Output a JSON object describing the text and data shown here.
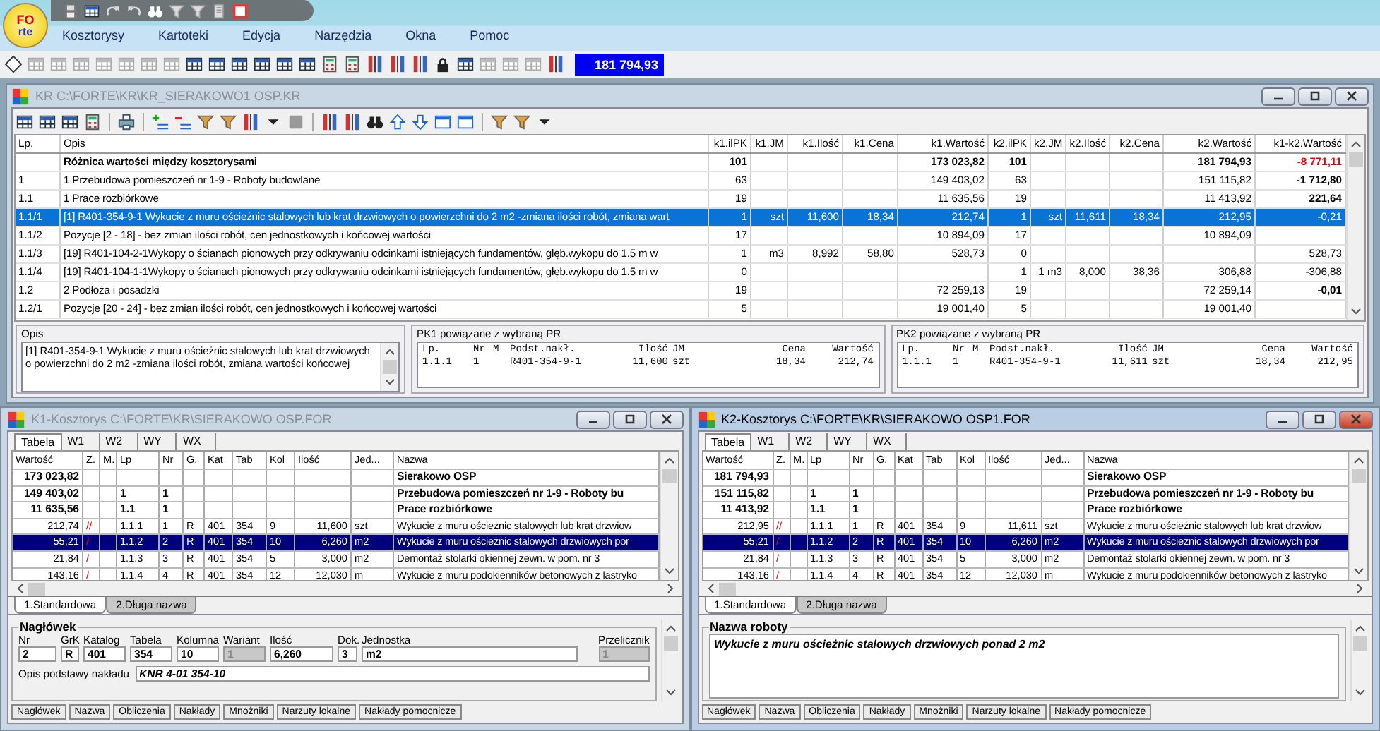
{
  "app": {
    "logo": [
      "FO",
      "rte"
    ],
    "menu": [
      "Kosztorysy",
      "Kartoteki",
      "Edycja",
      "Narzędzia",
      "Okna",
      "Pomoc"
    ],
    "counter": "181 794,93"
  },
  "kr_window": {
    "title": "KR C:\\FORTE\\KR\\KR_SIERAKOWO1 OSP.KR",
    "active": false,
    "columns": [
      "Lp.",
      "Opis",
      "k1.ilPK",
      "k1.JM",
      "k1.Ilość",
      "k1.Cena",
      "k1.Wartość",
      "k2.ilPK",
      "k2.JM",
      "k2.Ilość",
      "k2.Cena",
      "k2.Wartość",
      "k1-k2.Wartość"
    ],
    "rows": [
      {
        "opis": "Różnica wartości między kosztorysami",
        "bold": true,
        "selected": false,
        "k1": {
          "ilpk": "101",
          "wartosc": "173 023,82"
        },
        "k2": {
          "ilpk": "101",
          "wartosc": "181 794,93"
        },
        "diff": "-8 771,11",
        "diff_bold": true,
        "diff_alert": true
      },
      {
        "lp": "1",
        "opis": "1 Przebudowa pomieszczeń nr 1-9 - Roboty budowlane",
        "bold": false,
        "selected": false,
        "k1": {
          "ilpk": "63",
          "wartosc": "149 403,02"
        },
        "k2": {
          "ilpk": "63",
          "wartosc": "151 115,82"
        },
        "diff": "-1 712,80",
        "diff_bold": true,
        "diff_alert": false
      },
      {
        "lp": "1.1",
        "opis": "1 Prace rozbiórkowe",
        "bold": false,
        "selected": false,
        "k1": {
          "ilpk": "19",
          "wartosc": "11 635,56"
        },
        "k2": {
          "ilpk": "19",
          "wartosc": "11 413,92"
        },
        "diff": "221,64",
        "diff_bold": true,
        "diff_alert": false
      },
      {
        "lp": "1.1/1",
        "opis": "[1] R401-354-9-1 Wykucie z muru ościeżnic stalowych lub krat drzwiowych o powierzchni do 2 m2 -zmiana ilości robót, zmiana wart",
        "bold": false,
        "selected": true,
        "k1": {
          "ilpk": "1",
          "jm": "szt",
          "ilosc": "11,600",
          "cena": "18,34",
          "wartosc": "212,74"
        },
        "k2": {
          "ilpk": "1",
          "jm": "szt",
          "ilosc": "11,611",
          "cena": "18,34",
          "wartosc": "212,95"
        },
        "diff": "-0,21",
        "diff_bold": false,
        "diff_alert": false
      },
      {
        "lp": "1.1/2",
        "opis": "Pozycje [2 - 18] - bez zmian ilości robót, cen jednostkowych i końcowej wartości",
        "bold": false,
        "selected": false,
        "k1": {
          "ilpk": "17",
          "wartosc": "10 894,09"
        },
        "k2": {
          "ilpk": "17",
          "wartosc": "10 894,09"
        }
      },
      {
        "lp": "1.1/3",
        "opis": "[19] R401-104-2-1Wykopy o ścianach pionowych przy odkrywaniu odcinkami istniejących fundamentów, głęb.wykopu do 1.5 m w",
        "bold": false,
        "selected": false,
        "k1": {
          "ilpk": "1",
          "jm": "m3",
          "ilosc": "8,992",
          "cena": "58,80",
          "wartosc": "528,73"
        },
        "k2": {
          "ilpk": "0"
        },
        "diff": "528,73",
        "diff_bold": false,
        "diff_alert": false
      },
      {
        "lp": "1.1/4",
        "opis": "[19] R401-104-1-1Wykopy o ścianach pionowych przy odkrywaniu odcinkami istniejących fundamentów, głęb.wykopu do 1.5 m w",
        "bold": false,
        "selected": false,
        "k1": {
          "ilpk": "0"
        },
        "k2": {
          "ilpk": "1",
          "jm": "1 m3",
          "ilosc": "8,000",
          "cena": "38,36",
          "wartosc": "306,88"
        },
        "diff": "-306,88",
        "diff_bold": false,
        "diff_alert": false
      },
      {
        "lp": "1.2",
        "opis": "2 Podłoża i posadzki",
        "bold": false,
        "selected": false,
        "k1": {
          "ilpk": "19",
          "wartosc": "72 259,13"
        },
        "k2": {
          "ilpk": "19",
          "wartosc": "72 259,14"
        },
        "diff": "-0,01",
        "diff_bold": true,
        "diff_alert": false
      },
      {
        "lp": "1.2/1",
        "opis": "Pozycje [20 - 24] - bez zmian ilości robót, cen jednostkowych i końcowej wartości",
        "bold": false,
        "selected": false,
        "k1": {
          "ilpk": "5",
          "wartosc": "19 001,40"
        },
        "k2": {
          "ilpk": "5",
          "wartosc": "19 001,40"
        }
      }
    ],
    "opis_panel": {
      "label": "Opis",
      "text": "[1] R401-354-9-1 Wykucie z muru ościeżnic stalowych lub krat drzwiowych o powierzchni do 2 m2 -zmiana ilości robót, zmiana wartości końcowej"
    },
    "pk_panels": [
      {
        "title": "PK1 powiązane z wybraną PR",
        "columns": [
          "Lp.",
          "Nr",
          "M",
          "Podst.nakł.",
          "Ilość",
          "JM",
          "Cena",
          "Wartość"
        ],
        "row": {
          "lp": "1.1.1",
          "nr": "1",
          "podst": "R401-354-9-1",
          "ilosc": "11,600",
          "jm": "szt",
          "cena": "18,34",
          "wartosc": "212,74"
        }
      },
      {
        "title": "PK2 powiązane z wybraną PR",
        "columns": [
          "Lp.",
          "Nr",
          "M",
          "Podst.nakł.",
          "Ilość",
          "JM",
          "Cena",
          "Wartość"
        ],
        "row": {
          "lp": "1.1.1",
          "nr": "1",
          "podst": "R401-354-9-1",
          "ilosc": "11,611",
          "jm": "szt",
          "cena": "18,34",
          "wartosc": "212,95"
        }
      }
    ]
  },
  "estimate_windows": [
    {
      "title": "K1-Kosztorys C:\\FORTE\\KR\\SIERAKOWO OSP.FOR",
      "active": false,
      "tabs": [
        {
          "label": "Tabela",
          "selected": true
        },
        {
          "label": "W1",
          "selected": false
        },
        {
          "label": "W2",
          "selected": false
        },
        {
          "label": "WY",
          "selected": false
        },
        {
          "label": "WX",
          "selected": false
        }
      ],
      "columns": [
        "Wartość",
        "Z.",
        "M.",
        "Lp",
        "Nr",
        "G.",
        "Kat",
        "Tab",
        "Kol",
        "Ilość",
        "Jed...",
        "Nazwa"
      ],
      "rows": [
        {
          "wartosc": "173 023,82",
          "nazwa": "Sierakowo OSP",
          "bold": true,
          "selected": false
        },
        {
          "wartosc": "149 403,02",
          "lp": "1",
          "nr": "1",
          "nazwa": "Przebudowa pomieszczeń nr 1-9 - Roboty bu",
          "bold": true,
          "selected": false
        },
        {
          "wartosc": "11 635,56",
          "lp": "1.1",
          "nr": "1",
          "nazwa": "Prace rozbiórkowe",
          "bold": true,
          "selected": false
        },
        {
          "wartosc": "212,74",
          "z": "//",
          "lp": "1.1.1",
          "nr": "1",
          "g": "R",
          "kat": "401",
          "tab": "354",
          "kol": "9",
          "ilosc": "11,600",
          "jed": "szt",
          "nazwa": "Wykucie z muru ościeżnic stalowych lub krat drzwiow",
          "bold": false,
          "selected": false
        },
        {
          "wartosc": "55,21",
          "z": "/",
          "lp": "1.1.2",
          "nr": "2",
          "g": "R",
          "kat": "401",
          "tab": "354",
          "kol": "10",
          "ilosc": "6,260",
          "jed": "m2",
          "nazwa": "Wykucie z muru ościeżnic stalowych drzwiowych por",
          "bold": false,
          "selected": true
        },
        {
          "wartosc": "21,84",
          "z": "/",
          "lp": "1.1.3",
          "nr": "3",
          "g": "R",
          "kat": "401",
          "tab": "354",
          "kol": "5",
          "ilosc": "3,000",
          "jed": "m2",
          "nazwa": "Demontaż stolarki okiennej zewn. w pom. nr 3",
          "bold": false,
          "selected": false
        },
        {
          "wartosc": "143,16",
          "z": "/",
          "lp": "1.1.4",
          "nr": "4",
          "g": "R",
          "kat": "401",
          "tab": "354",
          "kol": "12",
          "ilosc": "12,030",
          "jed": "m",
          "nazwa": "Wykucie z muru podokienników betonowych z lastryko",
          "bold": false,
          "selected": false
        }
      ],
      "subtabs": [
        {
          "label": "1.Standardowa",
          "selected": true
        },
        {
          "label": "2.Długa nazwa",
          "selected": false
        }
      ],
      "detail": {
        "kind": "header",
        "title": "Nagłówek",
        "fields": [
          {
            "label": "Nr",
            "value": "2",
            "disabled": false
          },
          {
            "label": "GrK",
            "value": "R",
            "disabled": false
          },
          {
            "label": "Katalog",
            "value": "401",
            "disabled": false
          },
          {
            "label": "Tabela",
            "value": "354",
            "disabled": false
          },
          {
            "label": "Kolumna",
            "value": "10",
            "disabled": false
          },
          {
            "label": "Wariant",
            "value": "1",
            "disabled": true
          },
          {
            "label": "Ilość",
            "value": "6,260",
            "disabled": false
          },
          {
            "label": "Dok.",
            "value": "3",
            "disabled": false
          },
          {
            "label": "Jednostka",
            "value": "m2",
            "disabled": false
          },
          {
            "label": "Przelicznik",
            "value": "1",
            "disabled": true
          }
        ],
        "basis_label": "Opis podstawy nakładu",
        "basis_value": "KNR 4-01 354-10"
      },
      "buttons": [
        "Nagłówek",
        "Nazwa",
        "Obliczenia",
        "Nakłady",
        "Mnożniki",
        "Narzuty lokalne",
        "Nakłady pomocnicze"
      ]
    },
    {
      "title": "K2-Kosztorys C:\\FORTE\\KR\\SIERAKOWO OSP1.FOR",
      "active": true,
      "tabs": [
        {
          "label": "Tabela",
          "selected": true
        },
        {
          "label": "W1",
          "selected": false
        },
        {
          "label": "W2",
          "selected": false
        },
        {
          "label": "WY",
          "selected": false
        },
        {
          "label": "WX",
          "selected": false
        }
      ],
      "columns": [
        "Wartość",
        "Z.",
        "M.",
        "Lp",
        "Nr",
        "G.",
        "Kat",
        "Tab",
        "Kol",
        "Ilość",
        "Jed...",
        "Nazwa"
      ],
      "rows": [
        {
          "wartosc": "181 794,93",
          "nazwa": "Sierakowo OSP",
          "bold": true,
          "selected": false
        },
        {
          "wartosc": "151 115,82",
          "lp": "1",
          "nr": "1",
          "nazwa": "Przebudowa pomieszczeń nr 1-9 - Roboty bu",
          "bold": true,
          "selected": false
        },
        {
          "wartosc": "11 413,92",
          "lp": "1.1",
          "nr": "1",
          "nazwa": "Prace rozbiórkowe",
          "bold": true,
          "selected": false
        },
        {
          "wartosc": "212,95",
          "z": "//",
          "lp": "1.1.1",
          "nr": "1",
          "g": "R",
          "kat": "401",
          "tab": "354",
          "kol": "9",
          "ilosc": "11,611",
          "jed": "szt",
          "nazwa": "Wykucie z muru ościeżnic stalowych lub krat drzwiow",
          "bold": false,
          "selected": false
        },
        {
          "wartosc": "55,21",
          "z": "/",
          "lp": "1.1.2",
          "nr": "2",
          "g": "R",
          "kat": "401",
          "tab": "354",
          "kol": "10",
          "ilosc": "6,260",
          "jed": "m2",
          "nazwa": "Wykucie z muru ościeżnic stalowych drzwiowych por",
          "bold": false,
          "selected": true
        },
        {
          "wartosc": "21,84",
          "z": "/",
          "lp": "1.1.3",
          "nr": "3",
          "g": "R",
          "kat": "401",
          "tab": "354",
          "kol": "5",
          "ilosc": "3,000",
          "jed": "m2",
          "nazwa": "Demontaż stolarki okiennej zewn. w pom. nr 3",
          "bold": false,
          "selected": false
        },
        {
          "wartosc": "143,16",
          "z": "/",
          "lp": "1.1.4",
          "nr": "4",
          "g": "R",
          "kat": "401",
          "tab": "354",
          "kol": "12",
          "ilosc": "12,030",
          "jed": "m",
          "nazwa": "Wykucie z muru podokienników betonowych z lastryko",
          "bold": false,
          "selected": false
        }
      ],
      "subtabs": [
        {
          "label": "1.Standardowa",
          "selected": true
        },
        {
          "label": "2.Długa nazwa",
          "selected": false
        }
      ],
      "detail": {
        "kind": "name",
        "title": "Nazwa roboty",
        "text": "Wykucie z muru ościeżnic stalowych drzwiowych ponad 2 m2"
      },
      "buttons": [
        "Nagłówek",
        "Nazwa",
        "Obliczenia",
        "Nakłady",
        "Mnożniki",
        "Narzuty lokalne",
        "Nakłady pomocnicze"
      ]
    }
  ]
}
